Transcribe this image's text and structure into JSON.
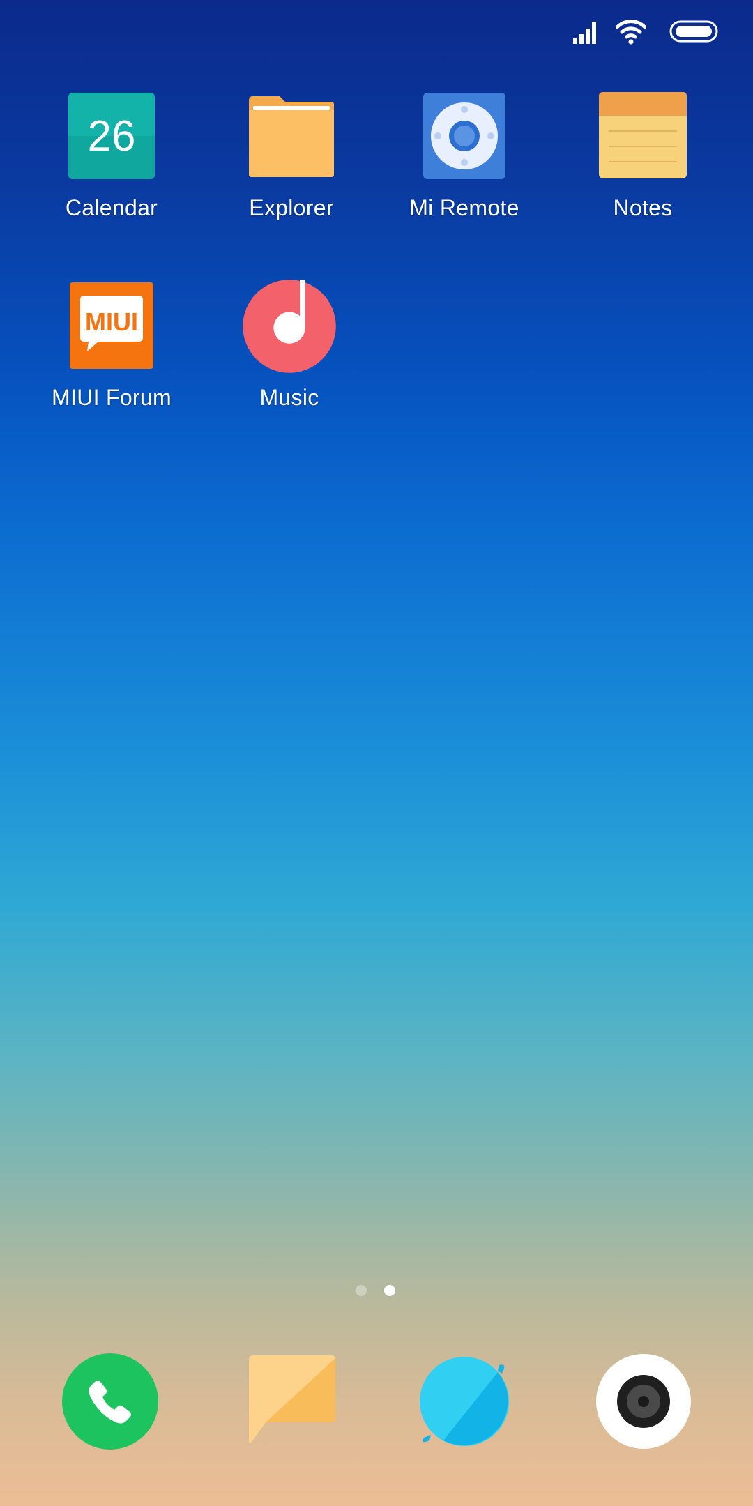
{
  "status_bar": {
    "icons": [
      "signal-icon",
      "wifi-icon",
      "battery-icon"
    ]
  },
  "home": {
    "apps": [
      {
        "label": "Calendar",
        "icon": "calendar-icon",
        "badge_text": "26",
        "color": "#14b3a9"
      },
      {
        "label": "Explorer",
        "icon": "folder-icon",
        "color": "#fdbf63"
      },
      {
        "label": "Mi Remote",
        "icon": "remote-icon",
        "color": "#3e7fd9"
      },
      {
        "label": "Notes",
        "icon": "notes-icon",
        "color": "#f7d27a"
      },
      {
        "label": "MIUI Forum",
        "icon": "miui-forum-icon",
        "logo_text": "MIUI",
        "color": "#f5740f"
      },
      {
        "label": "Music",
        "icon": "music-icon",
        "color": "#f3626b"
      }
    ]
  },
  "page_indicator": {
    "pages": 2,
    "current": 2
  },
  "dock": {
    "apps": [
      {
        "icon": "phone-icon",
        "color": "#1dc35f"
      },
      {
        "icon": "messaging-icon",
        "color": "#fbcf7d"
      },
      {
        "icon": "browser-icon",
        "color": "#1fc0f0"
      },
      {
        "icon": "camera-icon",
        "color": "#ffffff"
      }
    ]
  }
}
